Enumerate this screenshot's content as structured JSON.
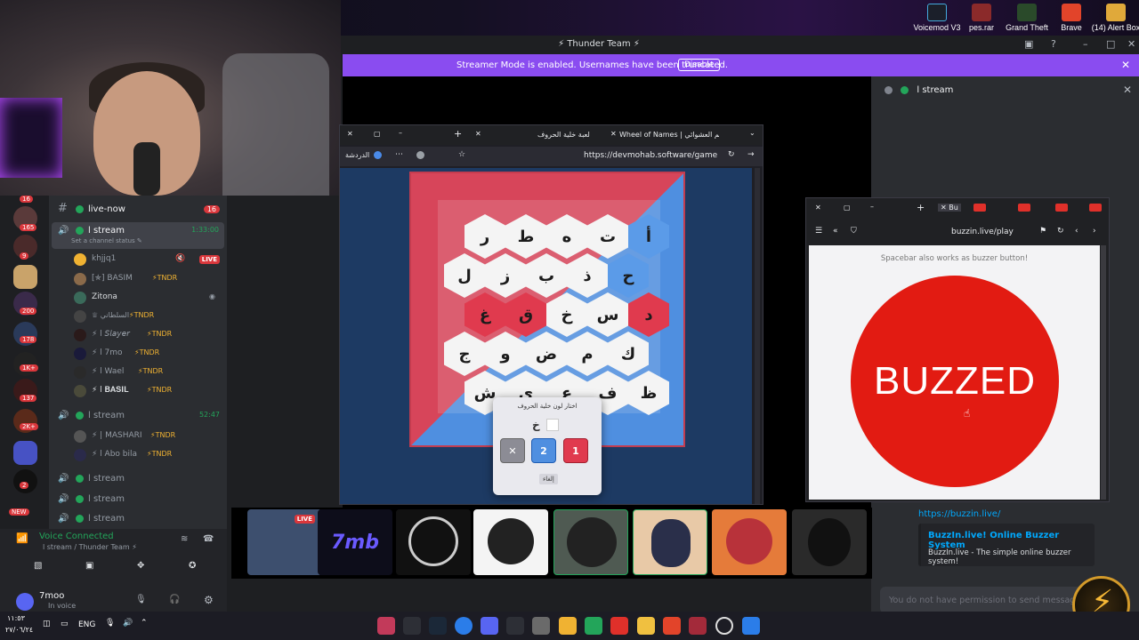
{
  "desktop": {
    "icons": [
      {
        "label": "Voicemod V3",
        "color": "#1b1f2a"
      },
      {
        "label": "pes.rar",
        "color": "#8b2a2a"
      },
      {
        "label": "Grand Theft",
        "color": "#2a4a2a"
      },
      {
        "label": "Brave",
        "color": "#e2442a"
      },
      {
        "label": "(14) Alert Box",
        "color": "#e0a93a"
      }
    ]
  },
  "window": {
    "title": "⚡ Thunder Team ⚡",
    "controls": [
      "▣",
      "?",
      "–",
      "□",
      "✕"
    ]
  },
  "banner": {
    "message": "Streamer Mode is enabled. Usernames have been truncated.",
    "disable_label": "Disable",
    "close": "✕"
  },
  "right_panel": {
    "header": "l stream",
    "link": "https://buzzin.live/",
    "embed_title": "BuzzIn.live! Online Buzzer System",
    "embed_desc": "BuzzIn.live - The simple online buzzer system!",
    "input_placeholder": "You do not have permission to send messages"
  },
  "channels": {
    "live_now": {
      "label": "live-now",
      "count": "16"
    },
    "stream1": {
      "label": "l stream",
      "time": "1:33:00",
      "status": "Set a channel status ✎"
    },
    "members1": [
      {
        "name": "khjjq1",
        "tag": "",
        "live": "LIVE"
      },
      {
        "name": "[✯] BASIM",
        "tag": "⚡TNDR",
        "live": ""
      },
      {
        "name": "Zitona",
        "tag": "",
        "live": ""
      },
      {
        "name": "♕ السلطاني",
        "tag": "⚡TNDR",
        "live": ""
      },
      {
        "name": "⚡ l 𝘚𝘭𝘢𝘺𝘦𝘳",
        "tag": "⚡TNDR",
        "live": ""
      },
      {
        "name": "⚡ l 7mo",
        "tag": "⚡TNDR",
        "live": ""
      },
      {
        "name": "⚡ l Wael",
        "tag": "⚡TNDR",
        "live": ""
      },
      {
        "name": "⚡ l 𝐁𝐀𝐒𝐈𝐋",
        "tag": "⚡TNDR",
        "live": ""
      }
    ],
    "stream2": {
      "label": "l stream",
      "time": "52:47"
    },
    "members2": [
      {
        "name": "⚡ | MASHARI",
        "tag": "⚡TNDR"
      },
      {
        "name": "⚡ l Abo bila",
        "tag": "⚡TNDR"
      }
    ],
    "more_streams": [
      "l stream",
      "l stream",
      "l stream"
    ]
  },
  "server_badges": [
    "16",
    "165",
    "9",
    "200",
    "178",
    "1K+",
    "137",
    "2K+",
    "2",
    "NEW"
  ],
  "voice": {
    "status": "Voice Connected",
    "channel": "l stream / Thunder Team ⚡",
    "user": "7moo",
    "sub": "In voice"
  },
  "thumbnails": [
    {
      "label": "LIVE",
      "color": "#3d4f6e"
    },
    {
      "label": "7mb",
      "color": "#0d0d1a"
    },
    {
      "label": "",
      "color": "#111"
    },
    {
      "label": "",
      "color": "#f4f4f4"
    },
    {
      "label": "",
      "color": "#4f5a52"
    },
    {
      "label": "",
      "color": "#e8c9a7"
    },
    {
      "label": "",
      "color": "#e57b3a"
    },
    {
      "label": "",
      "color": "#2a2a2a"
    }
  ],
  "game_browser": {
    "tabs": [
      "لعبة خلية الحروف",
      "Wheel of Names | الاسم العشوائي"
    ],
    "url": "https://devmohab.software/game",
    "profile_label": "الدردشة",
    "hex_rows": [
      [
        "ر",
        "ط",
        "ه",
        "ت",
        "أ"
      ],
      [
        "ل",
        "ز",
        "ب",
        "ذ",
        "ح"
      ],
      [
        "غ",
        "ق",
        "خ",
        "س",
        "د"
      ],
      [
        "ج",
        "و",
        "ض",
        "م",
        "ك"
      ],
      [
        "ش",
        "ي",
        "ع",
        "ف",
        "ظ"
      ]
    ],
    "hex_colors": [
      [
        "w",
        "w",
        "w",
        "w",
        "b"
      ],
      [
        "w",
        "w",
        "w",
        "w",
        "b"
      ],
      [
        "r",
        "r",
        "w",
        "w",
        "r"
      ],
      [
        "w",
        "w",
        "w",
        "w",
        "w"
      ],
      [
        "w",
        "w",
        "w",
        "w",
        "w"
      ]
    ],
    "popup": {
      "title": "اختار لون خلية الحروف",
      "letter": "خ",
      "buttons": [
        "✕",
        "2",
        "1"
      ],
      "cancel": "إلغاء"
    }
  },
  "buzzer_browser": {
    "url": "buzzin.live/play",
    "hint": "Spacebar also works as buzzer button!",
    "buzzed": "BUZZED"
  },
  "taskbar": {
    "time": "١١:٥٣",
    "date": "٢٧/٠٦/٢٤",
    "lang": "ENG"
  }
}
